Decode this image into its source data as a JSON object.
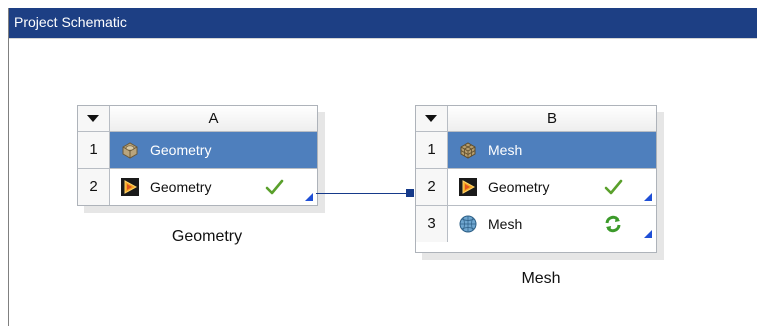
{
  "panel": {
    "title": "Project Schematic"
  },
  "systems": [
    {
      "column": "A",
      "rows": [
        {
          "num": "1",
          "label": "Geometry",
          "icon": "geometry-cube-icon",
          "status": ""
        },
        {
          "num": "2",
          "label": "Geometry",
          "icon": "designmodeler-icon",
          "status": "up-to-date-check-icon"
        }
      ],
      "name": "Geometry"
    },
    {
      "column": "B",
      "rows": [
        {
          "num": "1",
          "label": "Mesh",
          "icon": "mesh-block-icon",
          "status": ""
        },
        {
          "num": "2",
          "label": "Geometry",
          "icon": "designmodeler-icon",
          "status": "up-to-date-check-icon"
        },
        {
          "num": "3",
          "label": "Mesh",
          "icon": "mesh-sphere-icon",
          "status": "refresh-required-icon"
        }
      ],
      "name": "Mesh"
    }
  ],
  "colors": {
    "title_bar": "#1d3f84",
    "selected_row": "#4e7fbd",
    "connector": "#163a8a",
    "check": "#5aa02c"
  }
}
